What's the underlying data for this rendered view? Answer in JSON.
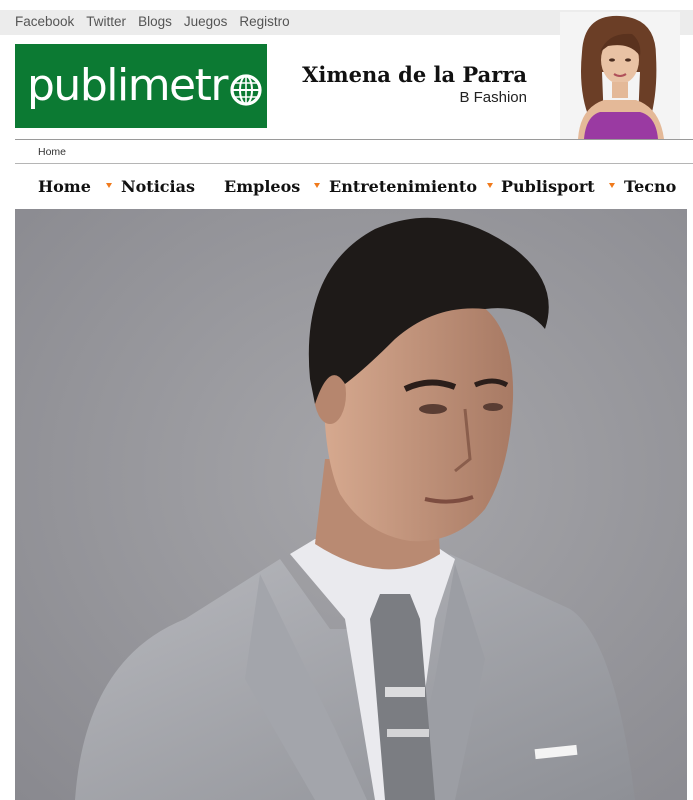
{
  "top_links": [
    "Facebook",
    "Twitter",
    "Blogs",
    "Juegos",
    "Registro"
  ],
  "logo": {
    "text": "publimetr",
    "brand_color": "#0c7a33"
  },
  "author": {
    "name": "Ximena de la Parra",
    "blog": "B Fashion"
  },
  "breadcrumb": "Home",
  "nav": {
    "items": [
      "Home",
      "Noticias",
      "Empleos",
      "Entretenimiento",
      "Publisport",
      "Tecno"
    ],
    "separator_color": "#f07a1c"
  },
  "hero": {
    "alt": "hero-photo"
  }
}
